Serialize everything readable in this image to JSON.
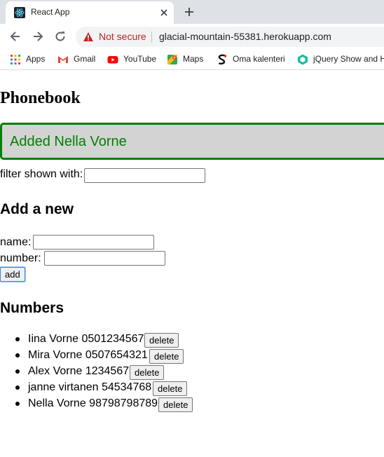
{
  "browser": {
    "tab_title": "React App",
    "security_label": "Not secure",
    "url": "glacial-mountain-55381.herokuapp.com",
    "bookmarks": [
      {
        "label": "Apps",
        "icon": "apps-grid-icon"
      },
      {
        "label": "Gmail",
        "icon": "gmail-icon"
      },
      {
        "label": "YouTube",
        "icon": "youtube-icon"
      },
      {
        "label": "Maps",
        "icon": "maps-icon"
      },
      {
        "label": "Oma kalenteri",
        "icon": "calendar-icon"
      },
      {
        "label": "jQuery Show and H",
        "icon": "jquery-icon"
      }
    ]
  },
  "page": {
    "title": "Phonebook",
    "notification": "Added Nella Vorne",
    "filter_label": "filter shown with:",
    "filter_value": "",
    "add_heading": "Add a new",
    "name_label": "name:",
    "name_value": "",
    "number_label": "number:",
    "number_value": "",
    "add_button": "add",
    "numbers_heading": "Numbers",
    "persons": [
      {
        "name": "Iina Vorne",
        "number": "0501234567",
        "display": "Iina Vorne 0501234567",
        "delete": "delete"
      },
      {
        "name": "Mira Vorne",
        "number": "0507654321",
        "display": "Mira Vorne 0507654321",
        "delete": "delete"
      },
      {
        "name": "Alex Vorne",
        "number": "1234567",
        "display": "Alex Vorne 1234567",
        "delete": "delete"
      },
      {
        "name": "janne virtanen",
        "number": "54534768",
        "display": "janne virtanen 54534768",
        "delete": "delete"
      },
      {
        "name": "Nella Vorne",
        "number": "98798798789",
        "display": "Nella Vorne 98798798789",
        "delete": "delete"
      }
    ]
  },
  "colors": {
    "notification_text": "#008000",
    "notification_border": "#008000",
    "notification_bg": "#d3d3d3",
    "not_secure": "#c5221f"
  }
}
